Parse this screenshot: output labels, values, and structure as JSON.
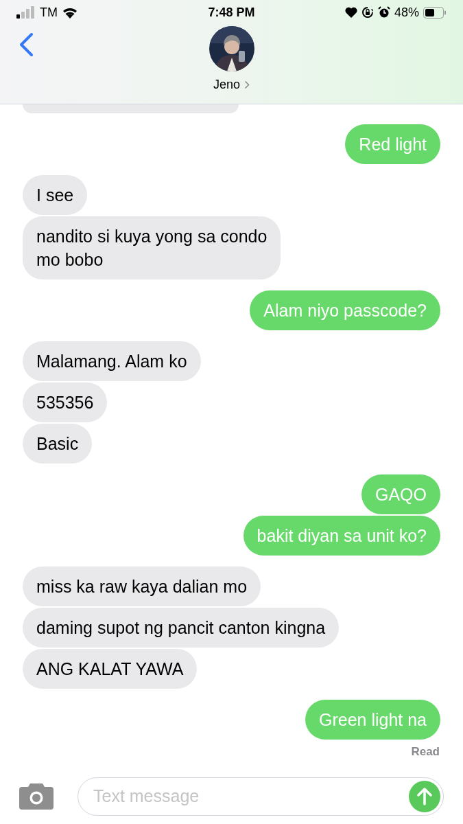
{
  "status_bar": {
    "carrier": "TM",
    "time": "7:48 PM",
    "battery": "48%"
  },
  "contact": {
    "name": "Jeno"
  },
  "messages": [
    {
      "kind": "cut_off"
    },
    {
      "kind": "sent",
      "text": "Red light"
    },
    {
      "kind": "received",
      "text": "I see"
    },
    {
      "kind": "received",
      "text": "nandito si kuya yong sa condo\nmo bobo"
    },
    {
      "kind": "sent",
      "text": "Alam niyo passcode?"
    },
    {
      "kind": "received",
      "text": "Malamang. Alam ko"
    },
    {
      "kind": "received",
      "text": "535356"
    },
    {
      "kind": "received",
      "text": "Basic"
    },
    {
      "kind": "sent",
      "text": "GAQO"
    },
    {
      "kind": "sent",
      "text": "bakit diyan sa unit ko?"
    },
    {
      "kind": "received",
      "text": "miss ka raw kaya dalian mo"
    },
    {
      "kind": "received",
      "text": "daming supot ng pancit canton kingna"
    },
    {
      "kind": "received",
      "text": "ANG KALAT YAWA"
    },
    {
      "kind": "sent",
      "text": "Green light na"
    }
  ],
  "receipt": "Read",
  "composer": {
    "placeholder": "Text message"
  }
}
